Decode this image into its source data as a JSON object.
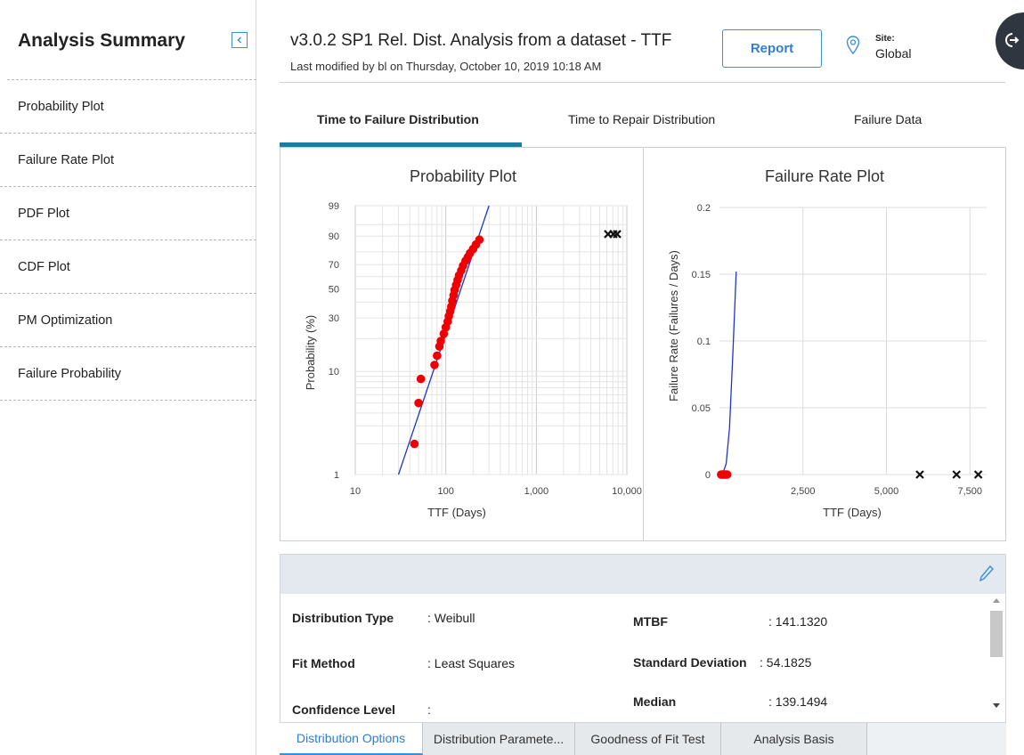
{
  "sidebar": {
    "title": "Analysis Summary",
    "items": [
      {
        "label": "Probability Plot"
      },
      {
        "label": "Failure Rate Plot"
      },
      {
        "label": "PDF Plot"
      },
      {
        "label": "CDF Plot"
      },
      {
        "label": "PM Optimization"
      },
      {
        "label": "Failure Probability"
      }
    ]
  },
  "header": {
    "title": "v3.0.2 SP1 Rel. Dist. Analysis from a dataset - TTF",
    "subtitle": "Last modified by bl on Thursday, October 10, 2019 10:18 AM",
    "report_label": "Report",
    "site_label": "Site:",
    "site_value": "Global"
  },
  "tabs": [
    {
      "label": "Time to Failure Distribution",
      "active": true
    },
    {
      "label": "Time to Repair Distribution",
      "active": false
    },
    {
      "label": "Failure Data",
      "active": false
    }
  ],
  "chart_data": [
    {
      "type": "scatter",
      "title": "Probability Plot",
      "xlabel": "TTF (Days)",
      "ylabel": "Probability (%)",
      "x_scale": "log",
      "y_scale": "weibull",
      "xlim": [
        10,
        10000
      ],
      "x_ticks": [
        "10",
        "100",
        "1,000",
        "10,000"
      ],
      "y_ticks": [
        "1",
        "10",
        "30",
        "50",
        "70",
        "90",
        "99"
      ],
      "grid": true,
      "series": [
        {
          "kind": "points",
          "color": "#ee0000",
          "points": [
            [
              45,
              2
            ],
            [
              50,
              5
            ],
            [
              53,
              8.5
            ],
            [
              75,
              11.5
            ],
            [
              80,
              14
            ],
            [
              85,
              17
            ],
            [
              88,
              19
            ],
            [
              95,
              22
            ],
            [
              100,
              25
            ],
            [
              105,
              28
            ],
            [
              108,
              31
            ],
            [
              112,
              34
            ],
            [
              115,
              37
            ],
            [
              118,
              41
            ],
            [
              122,
              45
            ],
            [
              125,
              49
            ],
            [
              130,
              53
            ],
            [
              135,
              57
            ],
            [
              140,
              61
            ],
            [
              148,
              65
            ],
            [
              155,
              69
            ],
            [
              165,
              73
            ],
            [
              175,
              76
            ],
            [
              185,
              79
            ],
            [
              200,
              82
            ],
            [
              215,
              85
            ],
            [
              235,
              88
            ]
          ]
        },
        {
          "kind": "fit-line",
          "color": "#2233cc",
          "points": [
            [
              30,
              1
            ],
            [
              300,
              99
            ]
          ]
        },
        {
          "kind": "censored",
          "color": "#111111",
          "points": [
            [
              6200,
              91
            ],
            [
              7100,
              91
            ],
            [
              7800,
              91
            ]
          ]
        }
      ]
    },
    {
      "type": "line",
      "title": "Failure Rate Plot",
      "xlabel": "TTF (Days)",
      "ylabel": "Failure Rate (Failures / Days)",
      "xlim": [
        0,
        8000
      ],
      "ylim": [
        0,
        0.2
      ],
      "x_ticks": [
        "2,500",
        "5,000",
        "7,500"
      ],
      "y_ticks": [
        "0",
        "0.05",
        "0.1",
        "0.15",
        "0.2"
      ],
      "grid": true,
      "series": [
        {
          "kind": "curve",
          "color": "#2233cc",
          "points": [
            [
              0,
              0
            ],
            [
              100,
              0.001
            ],
            [
              200,
              0.008
            ],
            [
              300,
              0.035
            ],
            [
              400,
              0.09
            ],
            [
              500,
              0.152
            ]
          ]
        },
        {
          "kind": "failures",
          "color": "#ee0000",
          "points": [
            [
              50,
              0
            ],
            [
              80,
              0
            ],
            [
              110,
              0
            ],
            [
              140,
              0
            ],
            [
              170,
              0
            ],
            [
              200,
              0
            ],
            [
              230,
              0
            ]
          ]
        },
        {
          "kind": "censored",
          "color": "#111111",
          "points": [
            [
              6000,
              0
            ],
            [
              7100,
              0
            ],
            [
              7750,
              0
            ]
          ]
        }
      ]
    }
  ],
  "details": {
    "rows": [
      {
        "label": "Distribution Type",
        "value": ": Weibull"
      },
      {
        "label": "Fit Method",
        "value": ": Least Squares"
      },
      {
        "label": "Confidence Level",
        "value": ":"
      },
      {
        "label": "MTBF",
        "value": ": 141.1320"
      },
      {
        "label": "Standard Deviation",
        "value": ": 54.1825"
      },
      {
        "label": "Median",
        "value": ": 139.1494"
      }
    ]
  },
  "bottom_tabs": [
    {
      "label": "Distribution Options",
      "active": true
    },
    {
      "label": "Distribution Paramete...",
      "active": false
    },
    {
      "label": "Goodness of Fit Test",
      "active": false
    },
    {
      "label": "Analysis Basis",
      "active": false
    }
  ],
  "colors": {
    "accent": "#197ea0",
    "primary_blue": "#2f7ed0",
    "failure_point": "#ee0000",
    "fit_line": "#2233cc",
    "details_bar": "#e4e9f0"
  },
  "icons": {
    "collapse": "collapse-left-icon",
    "site": "location-pin-icon",
    "fab": "exit-icon",
    "edit": "pencil-icon"
  }
}
